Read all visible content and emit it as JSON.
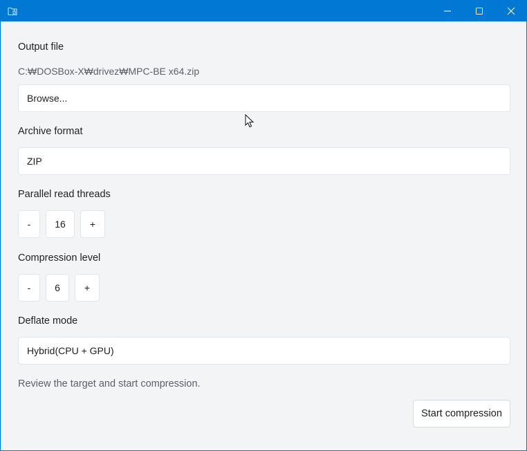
{
  "window": {
    "app_icon": "folder-zip-icon",
    "controls": {
      "minimize_icon": "minimize-icon",
      "maximize_icon": "maximize-icon",
      "close_icon": "close-icon"
    },
    "accent_color": "#0078d4"
  },
  "output": {
    "label": "Output file",
    "path": "C:₩DOSBox-X₩drivez₩MPC-BE x64.zip",
    "browse_label": "Browse..."
  },
  "archive": {
    "label": "Archive format",
    "value": "ZIP"
  },
  "threads": {
    "label": "Parallel read threads",
    "decrement": "-",
    "value": "16",
    "increment": "+"
  },
  "compression": {
    "label": "Compression level",
    "decrement": "-",
    "value": "6",
    "increment": "+"
  },
  "deflate": {
    "label": "Deflate mode",
    "value": "Hybrid(CPU + GPU)"
  },
  "status": {
    "text": "Review the target and start compression."
  },
  "actions": {
    "start_label": "Start compression"
  }
}
